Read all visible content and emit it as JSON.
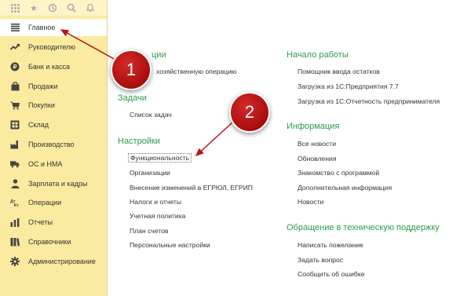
{
  "sidebar": {
    "items": [
      {
        "label": "Главное",
        "icon": "menu-lines-icon"
      },
      {
        "label": "Руководителю",
        "icon": "trend-chart-icon"
      },
      {
        "label": "Банк и касса",
        "icon": "coin-icon"
      },
      {
        "label": "Продажи",
        "icon": "shopping-bag-icon"
      },
      {
        "label": "Покупки",
        "icon": "cart-icon"
      },
      {
        "label": "Склад",
        "icon": "warehouse-icon"
      },
      {
        "label": "Производство",
        "icon": "factory-icon"
      },
      {
        "label": "ОС и НМА",
        "icon": "truck-icon"
      },
      {
        "label": "Зарплата и кадры",
        "icon": "person-icon"
      },
      {
        "label": "Операции",
        "icon": "dt-kt-icon"
      },
      {
        "label": "Отчеты",
        "icon": "bar-chart-icon"
      },
      {
        "label": "Справочники",
        "icon": "books-icon"
      },
      {
        "label": "Администрирование",
        "icon": "gear-icon"
      }
    ]
  },
  "toolbar": {
    "icons": [
      "apps-grid-icon",
      "star-icon",
      "history-icon",
      "search-icon",
      "bell-icon"
    ]
  },
  "main": {
    "left": {
      "sec1_partial_title": "ции",
      "sec1_link": "хозяйственную операцию",
      "tasks_title": "Задачи",
      "tasks_links": [
        "Список задач"
      ],
      "settings_title": "Настройки",
      "settings_links": [
        "Функциональность",
        "Организации",
        "Внесение изменений в ЕГРЮЛ, ЕГРИП",
        "Налоги и отчеты",
        "Учетная политика",
        "План счетов",
        "Персональные настройки"
      ]
    },
    "right": {
      "start_title": "Начало работы",
      "start_links": [
        "Помощник ввода остатков",
        "Загрузка из 1С:Предприятия 7.7",
        "Загрузка из 1С:Отчетность предпринимателя"
      ],
      "info_title": "Информация",
      "info_links": [
        "Все новости",
        "Обновления",
        "Знакомство с программой",
        "Дополнительная информация",
        "Новости"
      ],
      "support_title": "Обращение в техническую поддержку",
      "support_links": [
        "Написать пожелание",
        "Задать вопрос",
        "Сообщить об ошибке"
      ]
    }
  },
  "callouts": [
    {
      "number": "1"
    },
    {
      "number": "2"
    }
  ],
  "colors": {
    "sidebar_bg": "#fbeba0",
    "section_title": "#2e9a4e",
    "callout": "#b81414"
  }
}
